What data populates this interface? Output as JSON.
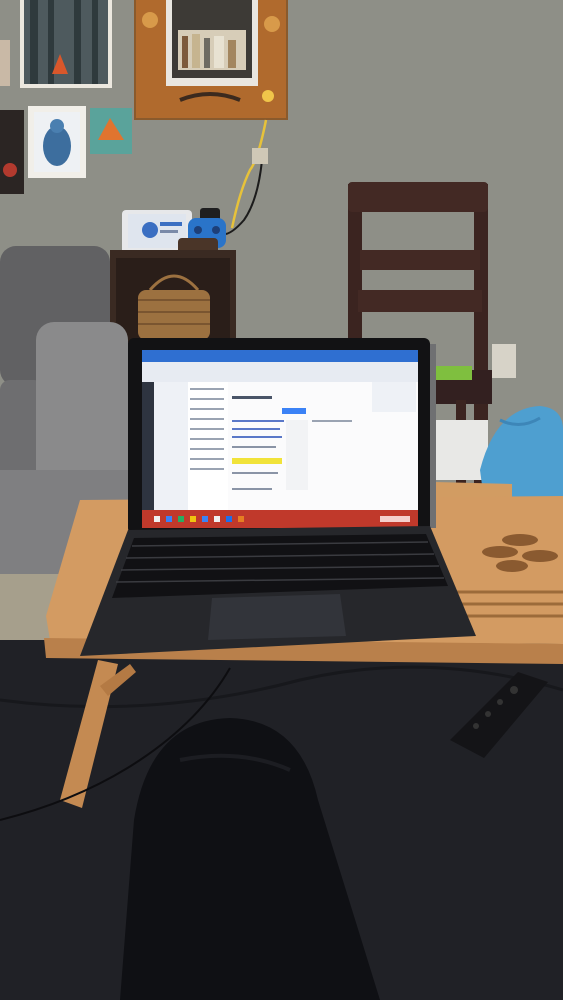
{
  "scene": {
    "wall_color": "#8e8f86",
    "floor_color": "#a39c8a",
    "couch_color": "#1e1f24",
    "table_color": "#c98f55",
    "sofa_color": "#7d7c7b"
  },
  "laptop": {
    "screen_app": "email-client",
    "taskbar_color": "#c0392b",
    "window_color": "#f3f4f6"
  }
}
